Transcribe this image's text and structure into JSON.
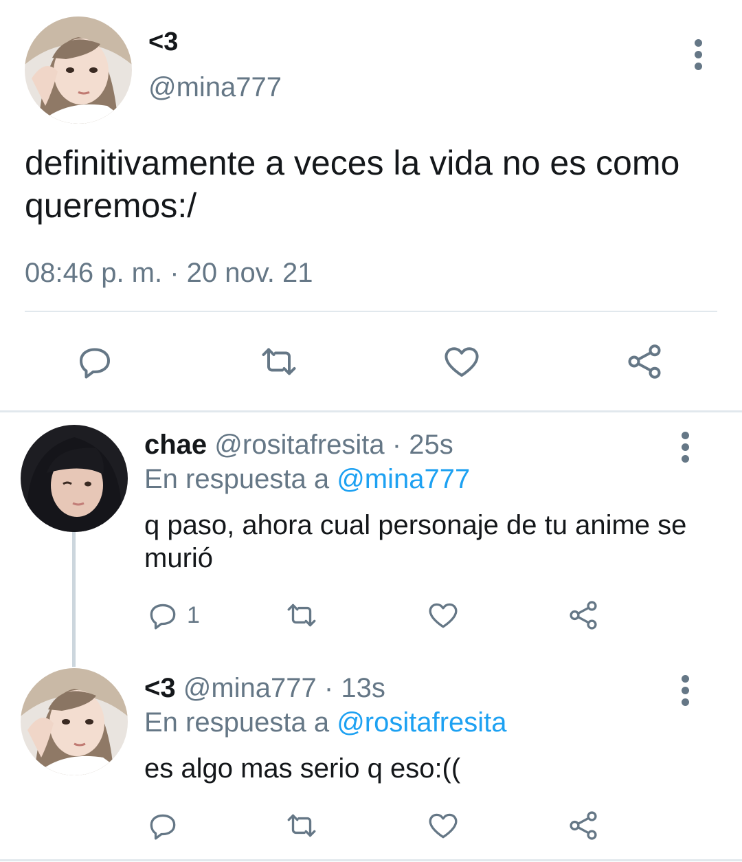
{
  "main_tweet": {
    "name": "<3",
    "handle": "@mina777",
    "text": "definitivamente a veces la vida no es como queremos:/",
    "timestamp": "08:46 p. m. · 20 nov. 21",
    "actions": [
      "reply-icon",
      "retweet-icon",
      "like-icon",
      "share-icon"
    ]
  },
  "replies": [
    {
      "name": "chae",
      "handle": "@rositafresita",
      "time": "· 25s",
      "reply_prefix": "En respuesta a",
      "reply_to": "@mina777",
      "text": "q paso, ahora cual personaje de tu anime se murió",
      "reply_count": "1"
    },
    {
      "name": "<3",
      "handle": "@mina777",
      "time": "· 13s",
      "reply_prefix": "En respuesta a",
      "reply_to": "@rositafresita",
      "text": "es algo mas serio q eso:((",
      "reply_count": ""
    }
  ],
  "colors": {
    "text": "#14171a",
    "muted": "#657786",
    "link": "#1da1f2",
    "divider": "#e1e8ed"
  }
}
